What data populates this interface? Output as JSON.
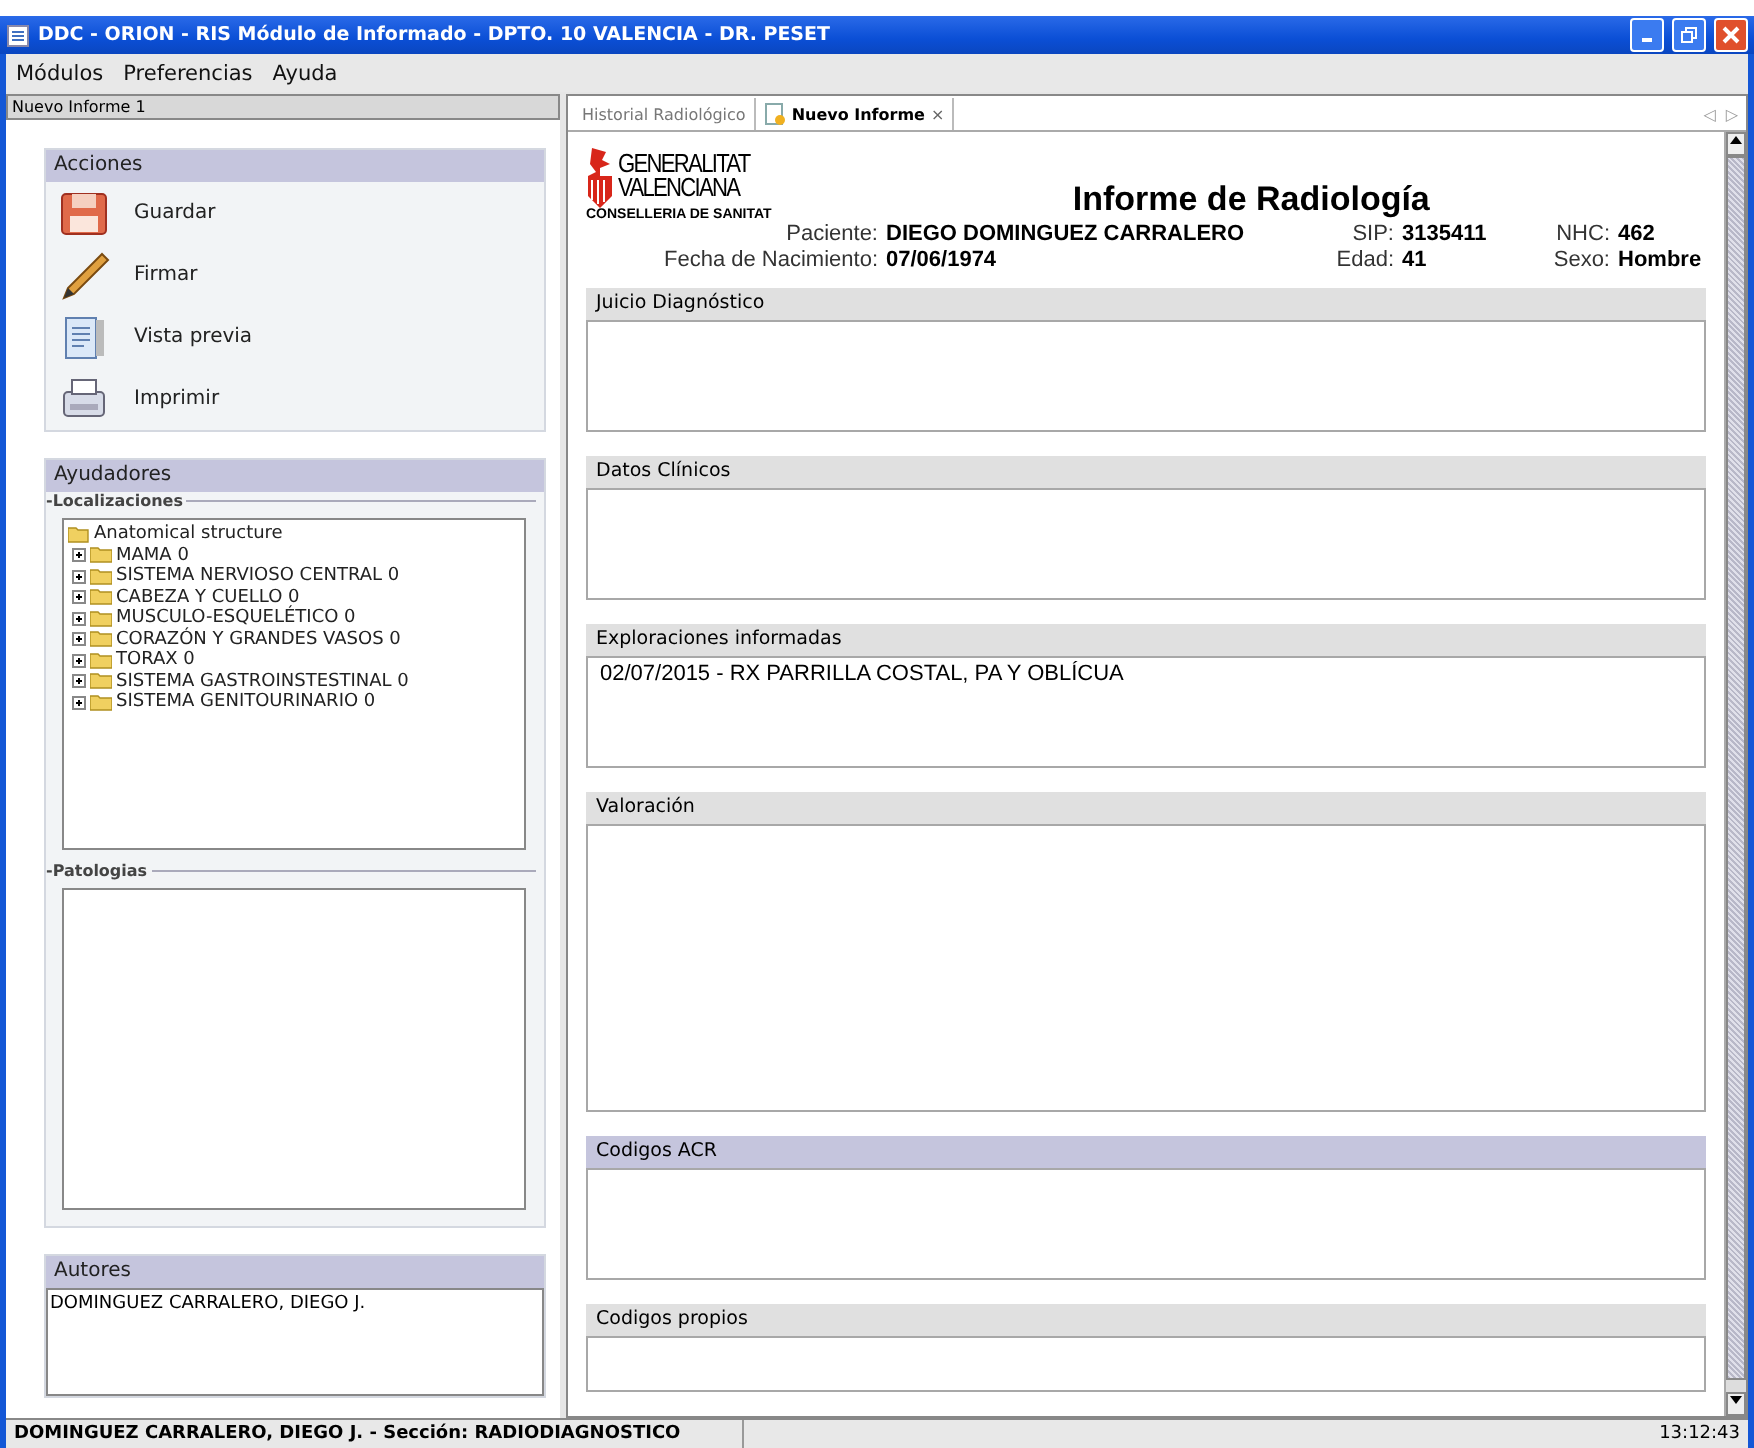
{
  "window": {
    "title": "DDC - ORION - RIS  Módulo de Informado - DPTO. 10 VALENCIA - DR. PESET"
  },
  "menu": [
    "Módulos",
    "Preferencias",
    "Ayuda"
  ],
  "document_label": "Nuevo Informe 1",
  "actions": {
    "title": "Acciones",
    "items": [
      {
        "kind": "save",
        "label": "Guardar"
      },
      {
        "kind": "sign",
        "label": "Firmar"
      },
      {
        "kind": "preview",
        "label": "Vista previa"
      },
      {
        "kind": "print",
        "label": "Imprimir"
      }
    ]
  },
  "helpers": {
    "title": "Ayudadores",
    "locations_label": "-Localizaciones",
    "tree": [
      {
        "label": "Anatomical structure",
        "expanded": true,
        "children": [
          {
            "label": "MAMA 0",
            "expanded": false
          },
          {
            "label": "SISTEMA NERVIOSO CENTRAL 0",
            "expanded": false
          },
          {
            "label": "CABEZA Y CUELLO 0",
            "expanded": false
          },
          {
            "label": "MUSCULO-ESQUELÉTICO 0",
            "expanded": false
          },
          {
            "label": "CORAZÓN Y GRANDES VASOS 0",
            "expanded": false
          },
          {
            "label": "TORAX 0",
            "expanded": false
          },
          {
            "label": "SISTEMA GASTROINSTESTINAL 0",
            "expanded": false
          },
          {
            "label": "SISTEMA GENITOURINARIO 0",
            "expanded": false
          }
        ]
      }
    ],
    "pathologies_label": "-Patologias"
  },
  "authors": {
    "title": "Autores",
    "items": [
      "DOMINGUEZ CARRALERO, DIEGO J."
    ]
  },
  "tabs": [
    {
      "label": "Historial Radiológico",
      "selected": false,
      "closable": false
    },
    {
      "label": "Nuevo Informe",
      "selected": true,
      "closable": true,
      "close": "×"
    }
  ],
  "tab_scroll": [
    "◁",
    "▷"
  ],
  "report": {
    "logo_lines": [
      "GENERALITAT",
      "VALENCIANA"
    ],
    "logo_subtitle": "CONSELLERIA DE SANITAT",
    "title": "Informe de Radiología",
    "patient_rows": [
      [
        {
          "label": "Paciente:",
          "value": "DIEGO DOMINGUEZ CARRALERO"
        },
        {
          "label": "SIP:",
          "value": "3135411"
        },
        {
          "label": "NHC:",
          "value": "462"
        }
      ],
      [
        {
          "label": "Fecha de Nacimiento:",
          "value": "07/06/1974"
        },
        {
          "label": "Edad:",
          "value": "41"
        },
        {
          "label": "Sexo:",
          "value": "Hombre"
        }
      ]
    ],
    "sections": [
      {
        "title": "Juicio Diagnóstico",
        "focused": false
      },
      {
        "title": "Datos Clínicos",
        "focused": false
      },
      {
        "title": "Exploraciones informadas",
        "focused": false,
        "text": "02/07/2015 -  RX PARRILLA COSTAL, PA Y OBLÍCUA"
      },
      {
        "title": "Valoración",
        "focused": false
      },
      {
        "title": "Codigos ACR",
        "focused": true
      },
      {
        "title": "Codigos propios",
        "focused": false
      }
    ]
  },
  "status_bar": {
    "user": "DOMINGUEZ CARRALERO, DIEGO J. - Sección: RADIODIAGNOSTICO",
    "time": "13:12:43"
  }
}
